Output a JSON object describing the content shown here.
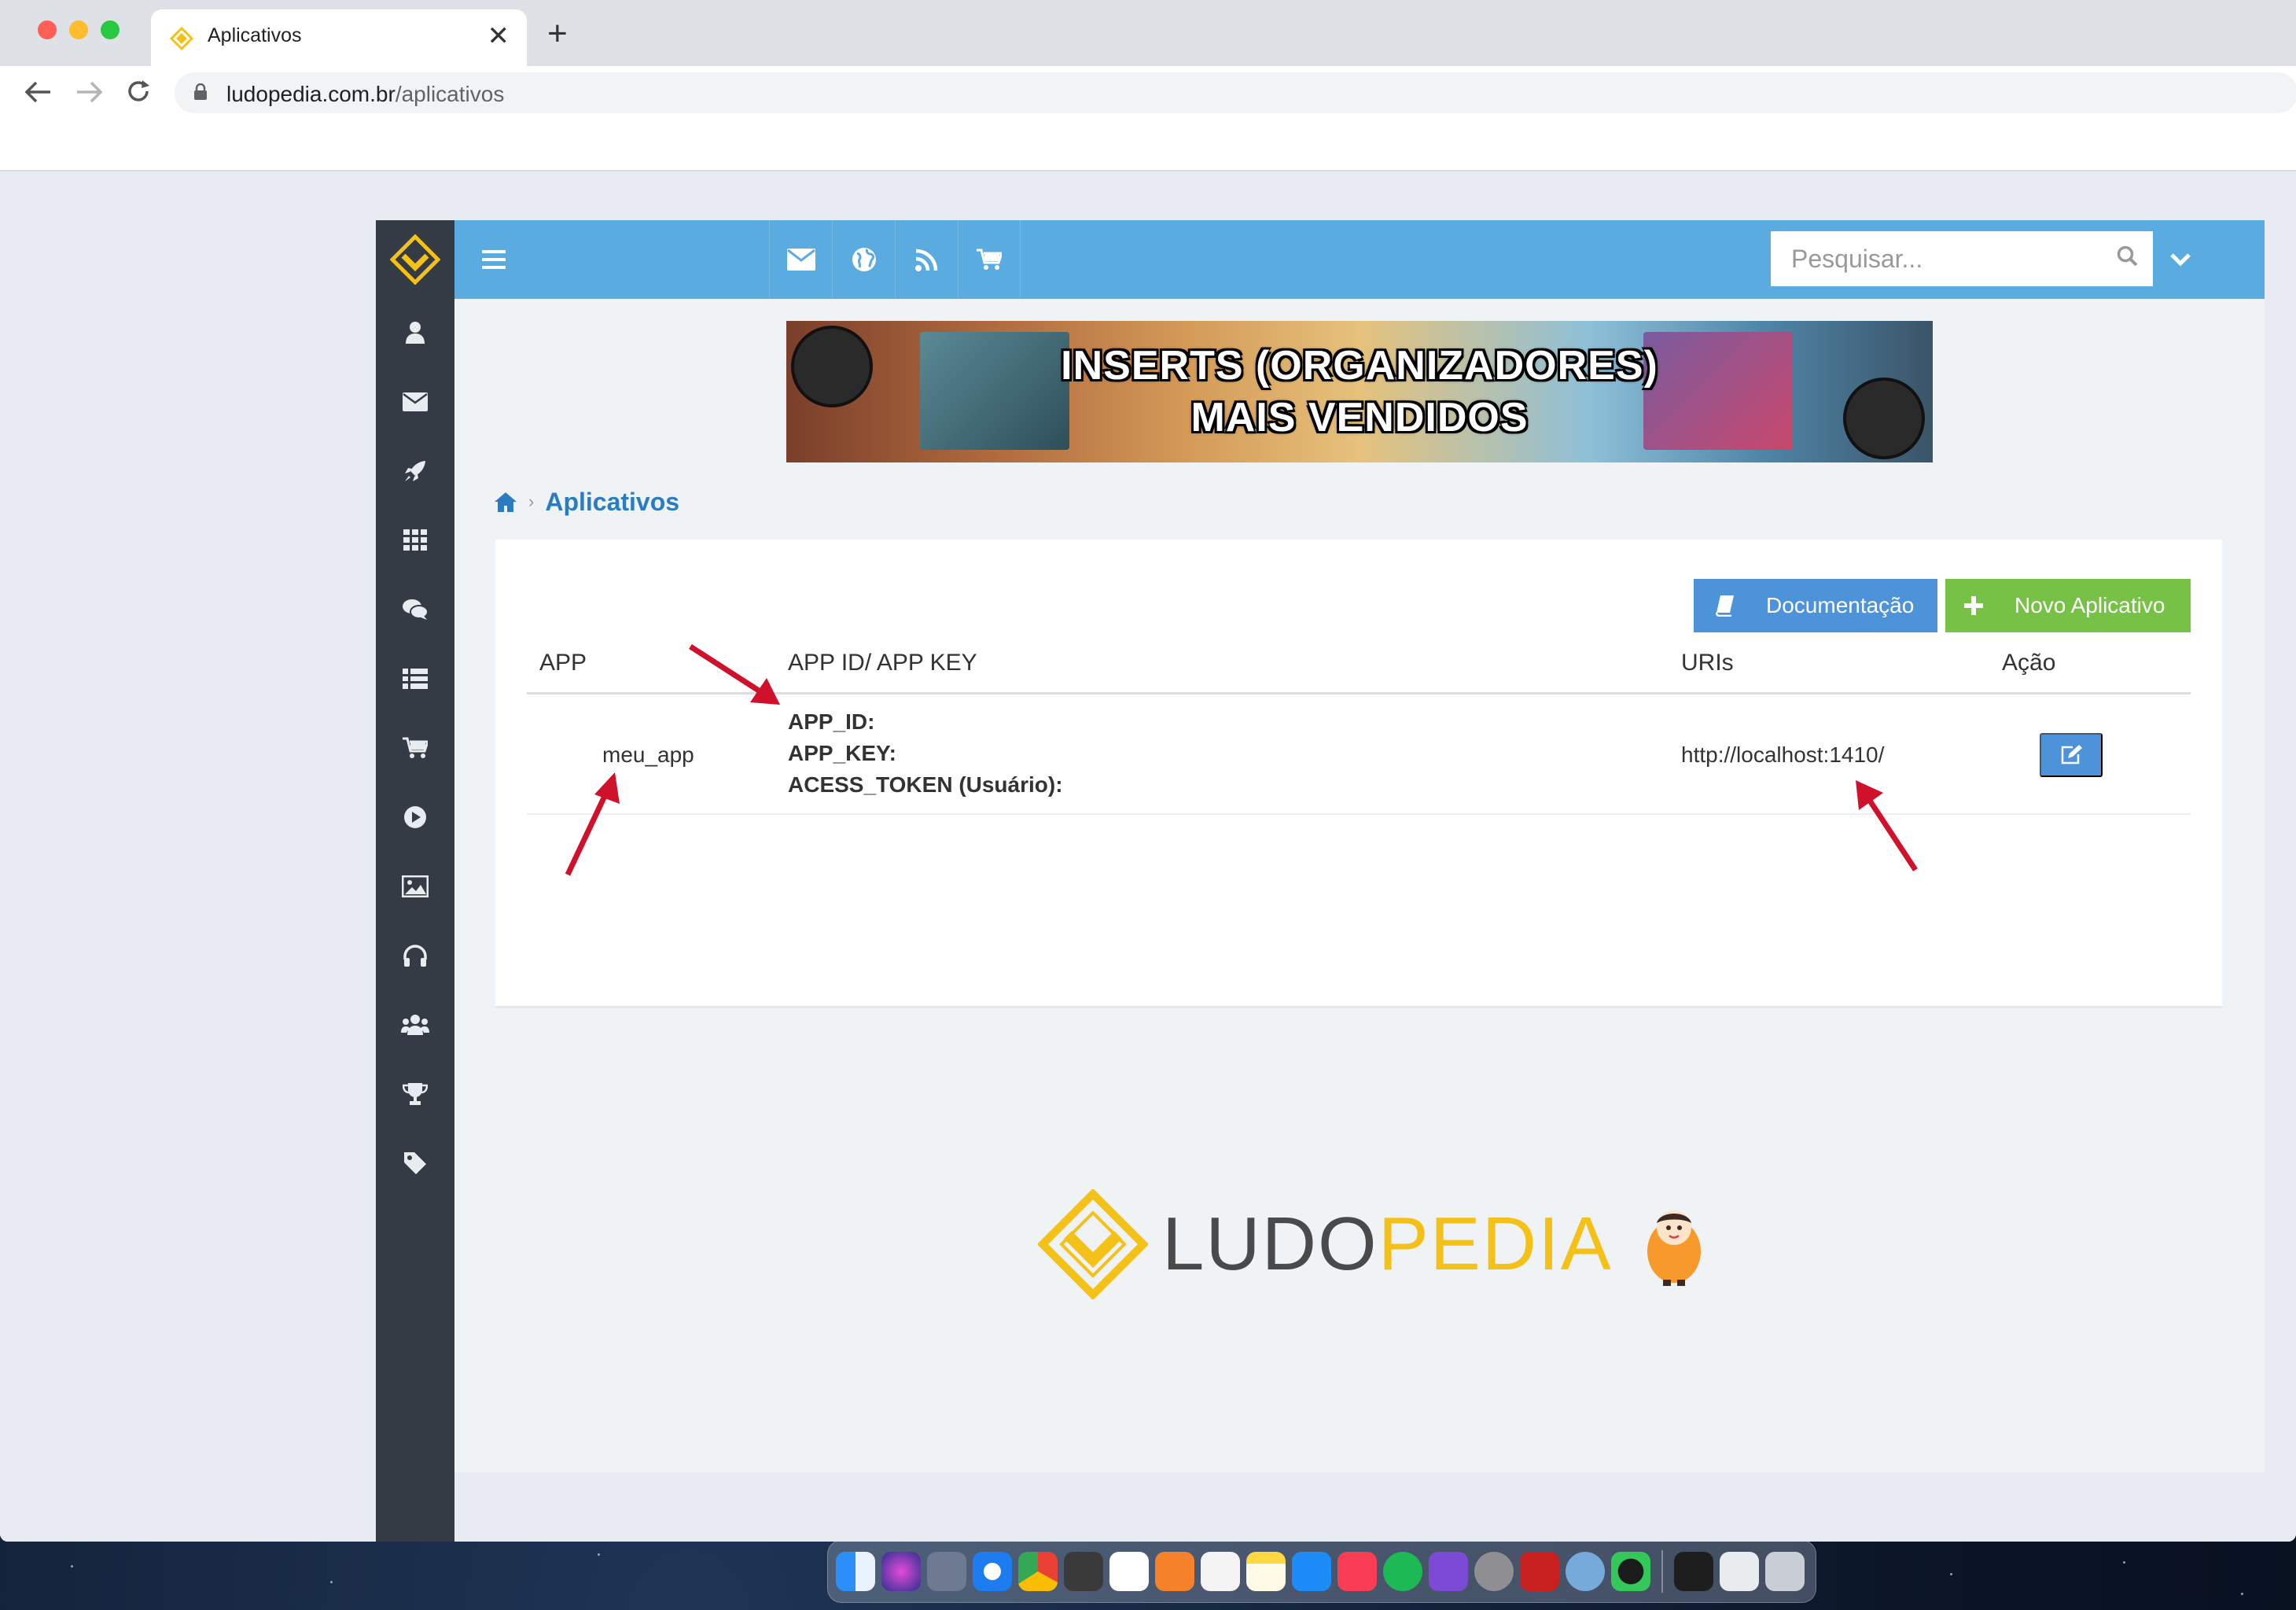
{
  "browser": {
    "tab_title": "Aplicativos",
    "tab_close": "✕",
    "new_tab": "+",
    "url_domain": "ludopedia.com.br",
    "url_path": "/aplicativos"
  },
  "topbar": {
    "search_placeholder": "Pesquisar..."
  },
  "banner": {
    "line1": "INSERTS (ORGANIZADORES)",
    "line2": "MAIS VENDIDOS"
  },
  "breadcrumb": {
    "separator": "›",
    "current": "Aplicativos"
  },
  "actions": {
    "documentation": "Documentação",
    "new_app": "Novo Aplicativo"
  },
  "table": {
    "headers": {
      "app": "APP",
      "app_id_key": "APP ID/ APP KEY",
      "uris": "URIs",
      "action": "Ação"
    },
    "rows": [
      {
        "app": "meu_app",
        "app_id_label": "APP_ID:",
        "app_key_label": "APP_KEY:",
        "access_token_label": "ACESS_TOKEN (Usuário):",
        "uri": "http://localhost:1410/"
      }
    ]
  },
  "footer": {
    "brand_part1": "LUDO",
    "brand_part2": "PEDIA"
  },
  "colors": {
    "sidebar": "#343b45",
    "topbar": "#5aace0",
    "brand_yellow": "#f4c118",
    "primary_button": "#4d93d9",
    "success_button": "#78c147",
    "annotation_arrow": "#d0112b"
  }
}
